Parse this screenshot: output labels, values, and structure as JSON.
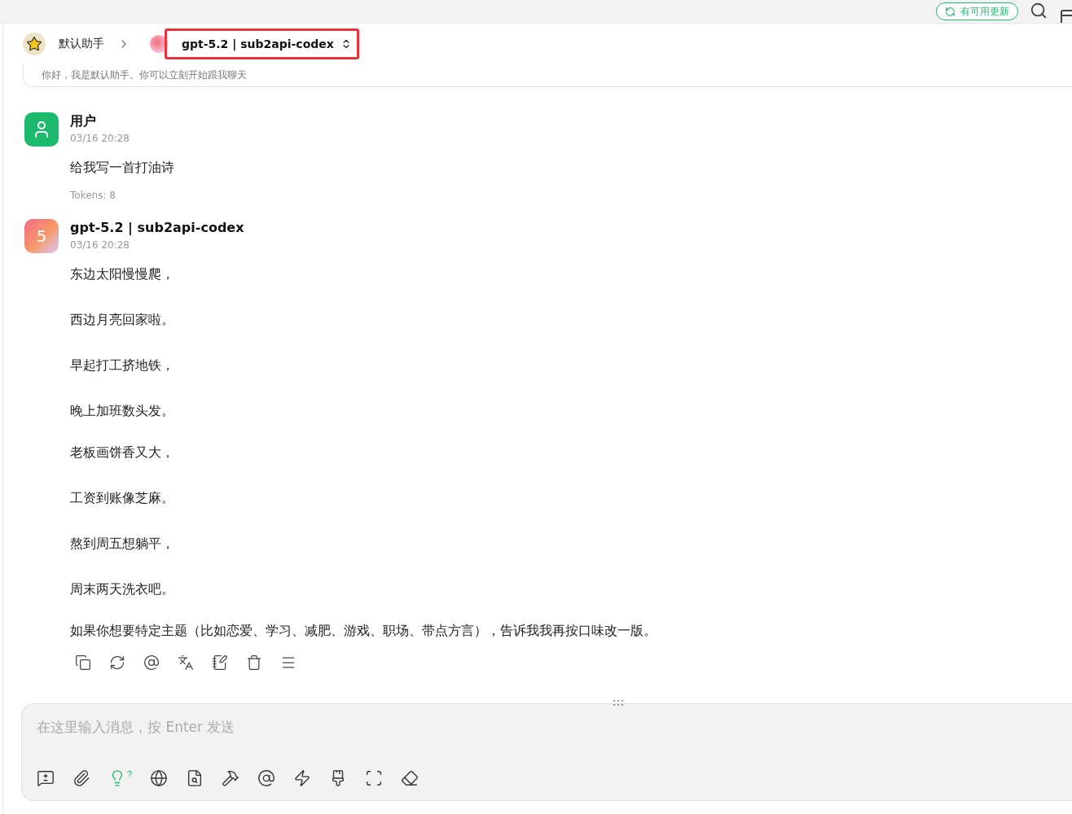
{
  "top_bar": {
    "update_button": "有可用更新"
  },
  "header": {
    "assistant_name": "默认助手",
    "model_selector": {
      "label": "gpt-5.2 | sub2api-codex",
      "highlighted": true
    }
  },
  "greeting": "你好，我是默认助手。你可以立刻开始跟我聊天",
  "messages": [
    {
      "kind": "user",
      "author": "用户",
      "time": "03/16 20:28",
      "paragraphs": [
        "给我写一首打油诗"
      ],
      "tokens": "Tokens: 8"
    },
    {
      "kind": "assistant",
      "author": "gpt-5.2 | sub2api-codex",
      "avatar_text": "5",
      "time": "03/16 20:28",
      "paragraphs": [
        "东边太阳慢慢爬，",
        "西边月亮回家啦。",
        "早起打工挤地铁，",
        "晚上加班数头发。",
        "老板画饼香又大，",
        "工资到账像芝麻。",
        "熬到周五想躺平，",
        "周末两天洗衣吧。",
        "如果你想要特定主题（比如恋爱、学习、减肥、游戏、职场、带点方言），告诉我我再按口味改一版。"
      ],
      "actions": [
        {
          "kind": "copy"
        },
        {
          "kind": "regenerate"
        },
        {
          "kind": "mention"
        },
        {
          "kind": "translate"
        },
        {
          "kind": "edit"
        },
        {
          "kind": "delete"
        },
        {
          "kind": "more"
        }
      ]
    }
  ],
  "composer": {
    "placeholder": "在这里输入消息，按 Enter 发送",
    "tools": [
      {
        "kind": "new-topic",
        "active": false
      },
      {
        "kind": "attach",
        "active": false
      },
      {
        "kind": "thinking",
        "active": true,
        "badge": "?"
      },
      {
        "kind": "web",
        "active": false
      },
      {
        "kind": "knowledge",
        "active": false
      },
      {
        "kind": "tools",
        "active": false
      },
      {
        "kind": "mention",
        "active": false
      },
      {
        "kind": "quick",
        "active": false
      },
      {
        "kind": "paint",
        "active": false
      },
      {
        "kind": "fullscreen",
        "active": false
      },
      {
        "kind": "clear",
        "active": false
      }
    ]
  }
}
